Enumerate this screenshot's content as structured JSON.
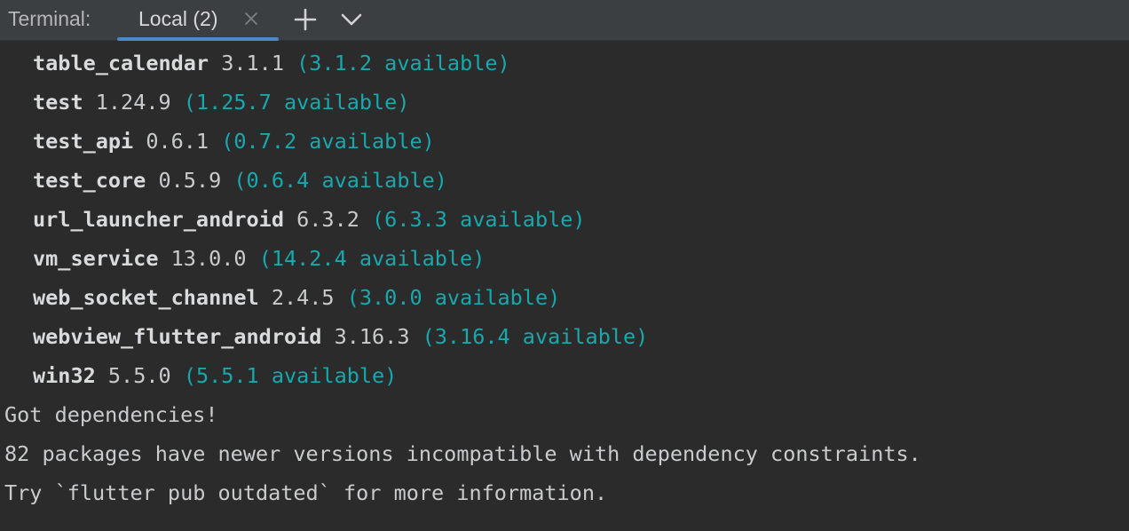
{
  "tabbar": {
    "title": "Terminal:",
    "active_tab": {
      "label": "Local (2)"
    },
    "add_icon": "plus-icon",
    "menu_icon": "chevron-down-icon",
    "close_icon": "close-icon",
    "accent_color": "#4a88c7"
  },
  "terminal": {
    "packages": [
      {
        "name": "table_calendar",
        "version": "3.1.1",
        "available": "(3.1.2 available)"
      },
      {
        "name": "test",
        "version": "1.24.9",
        "available": "(1.25.7 available)"
      },
      {
        "name": "test_api",
        "version": "0.6.1",
        "available": "(0.7.2 available)"
      },
      {
        "name": "test_core",
        "version": "0.5.9",
        "available": "(0.6.4 available)"
      },
      {
        "name": "url_launcher_android",
        "version": "6.3.2",
        "available": "(6.3.3 available)"
      },
      {
        "name": "vm_service",
        "version": "13.0.0",
        "available": "(14.2.4 available)"
      },
      {
        "name": "web_socket_channel",
        "version": "2.4.5",
        "available": "(3.0.0 available)"
      },
      {
        "name": "webview_flutter_android",
        "version": "3.16.3",
        "available": "(3.16.4 available)"
      },
      {
        "name": "win32",
        "version": "5.5.0",
        "available": "(5.5.1 available)"
      }
    ],
    "messages": [
      "Got dependencies!",
      "82 packages have newer versions incompatible with dependency constraints.",
      "Try `flutter pub outdated` for more information."
    ],
    "available_color": "#17a9ae"
  }
}
